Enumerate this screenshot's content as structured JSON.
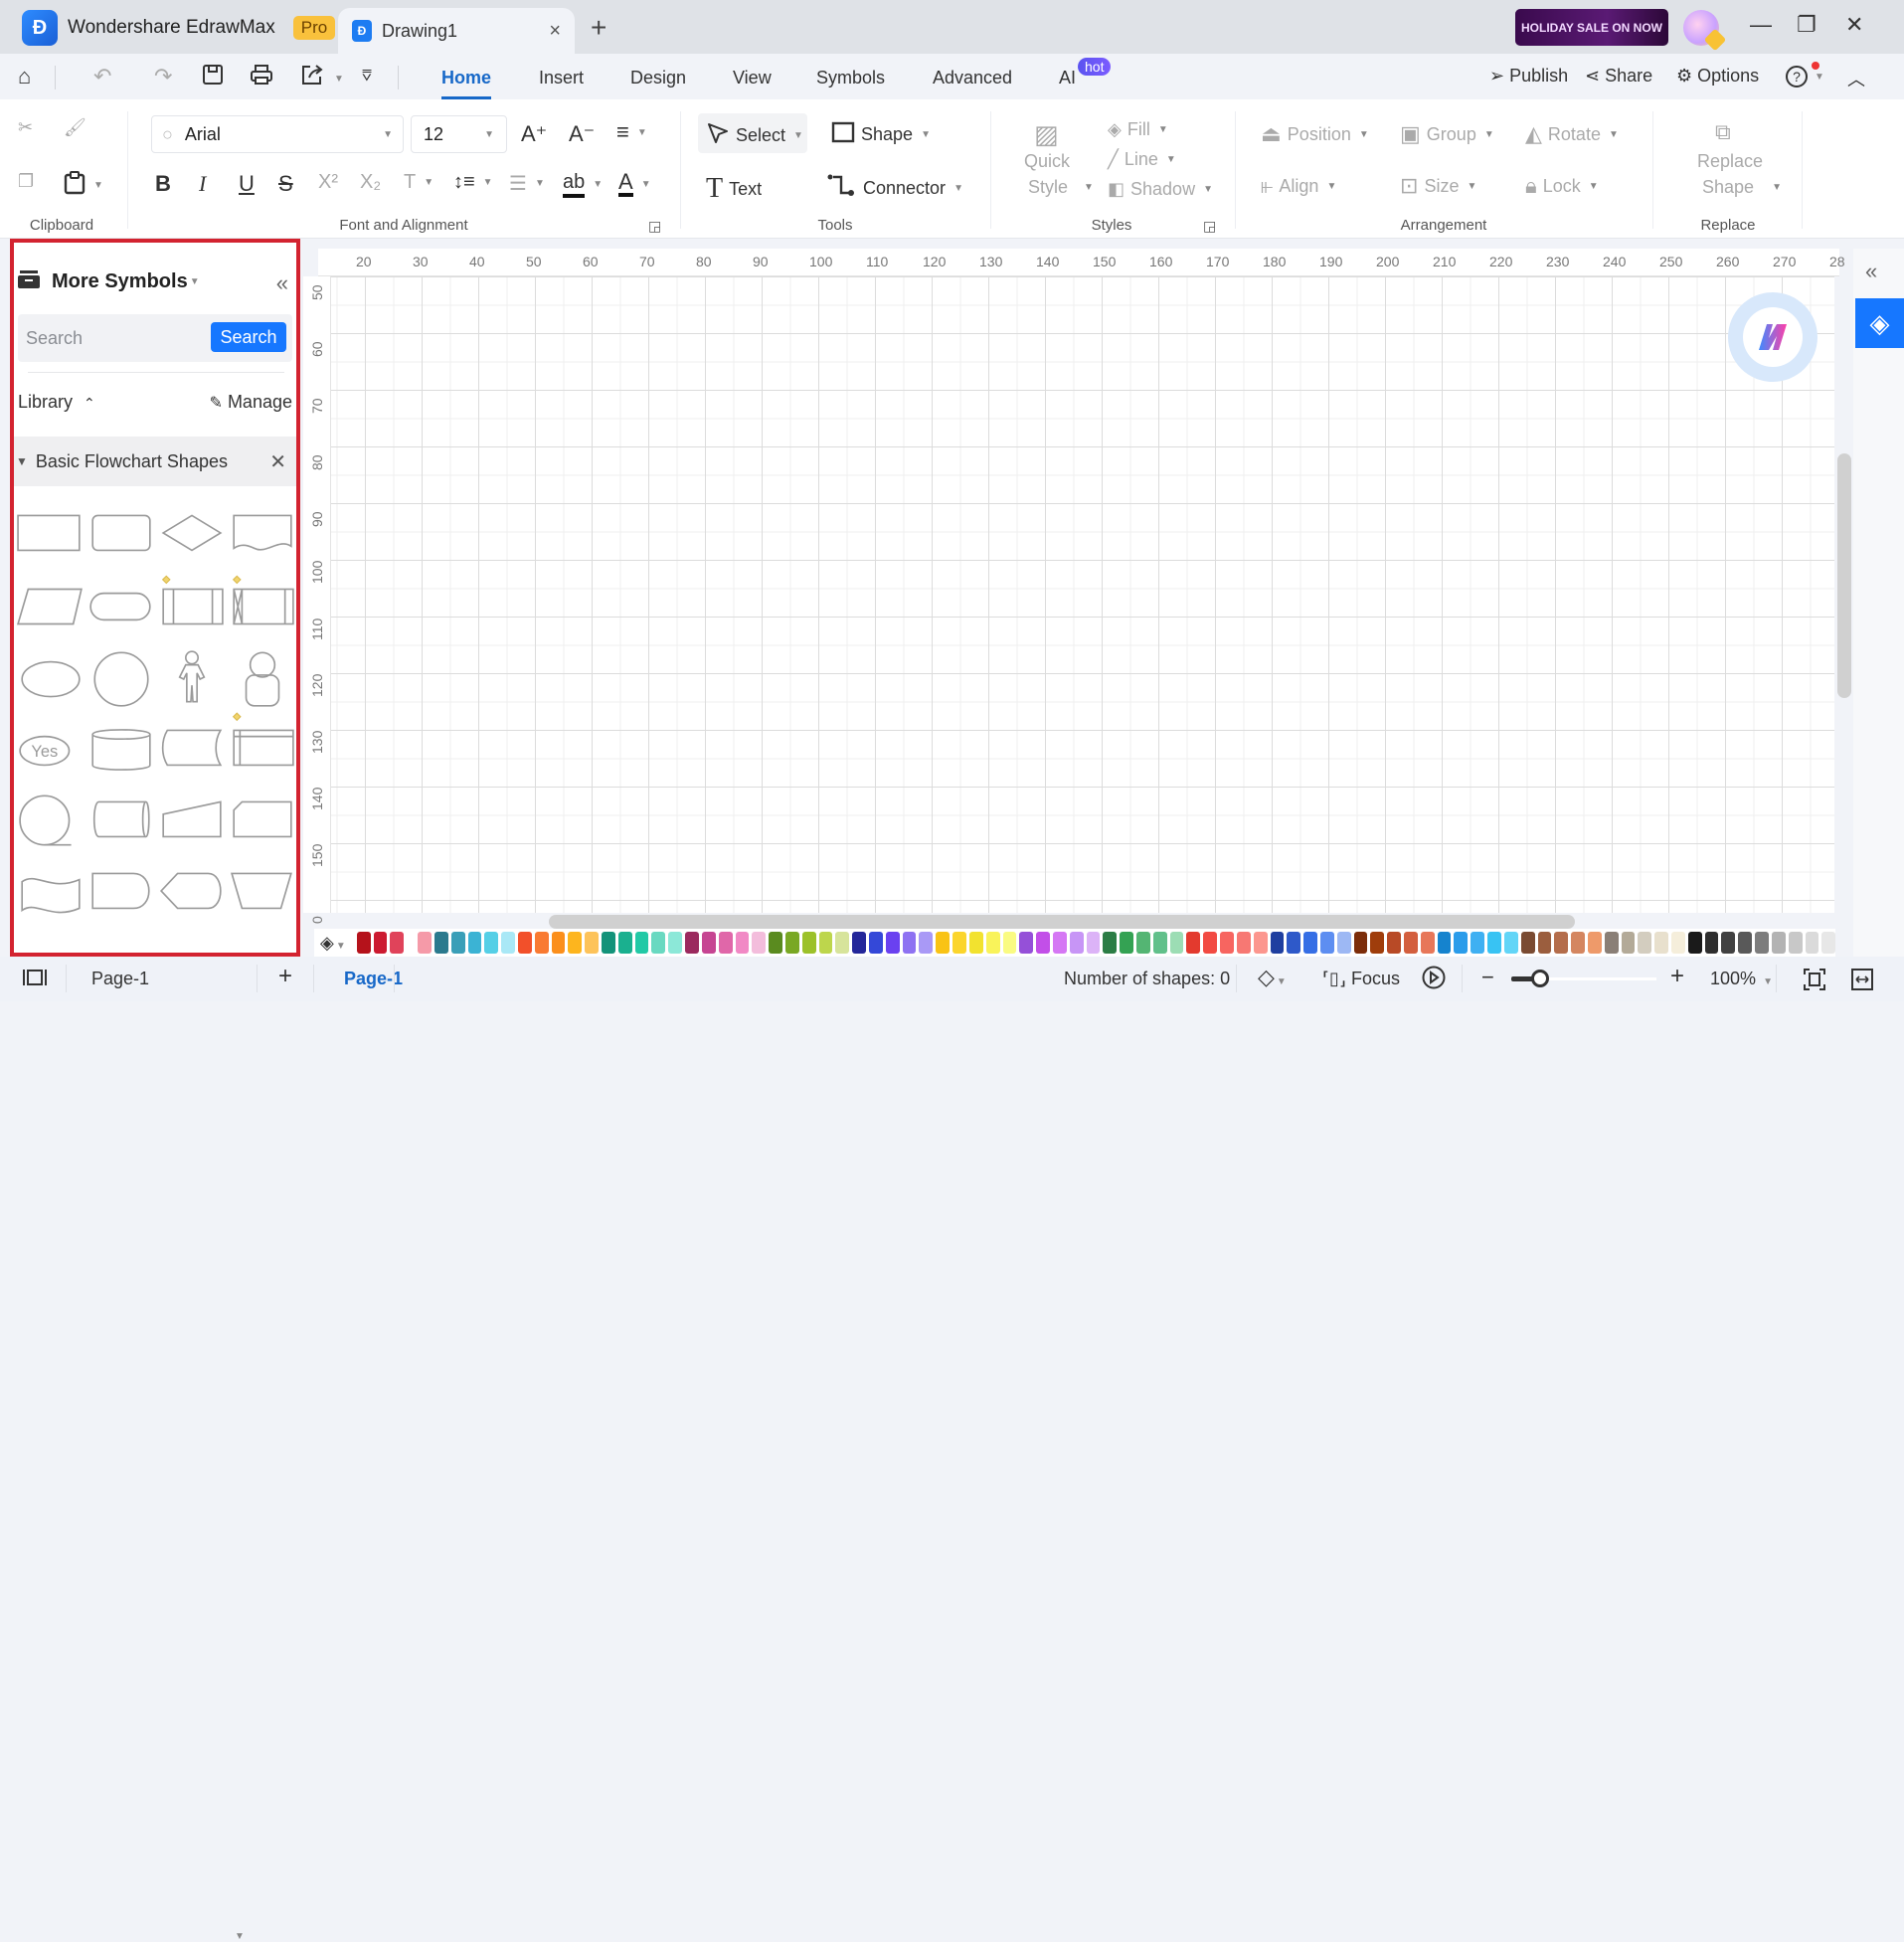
{
  "titlebar": {
    "app_name": "Wondershare EdrawMax",
    "pro_badge": "Pro",
    "doc_tab": "Drawing1",
    "tab_close": "×",
    "new_tab": "+",
    "sale_banner": "HOLIDAY SALE ON NOW",
    "window_controls": {
      "minimize": "—",
      "restore": "❐",
      "close": "✕"
    }
  },
  "quick_access": {
    "home": "⌂",
    "undo": "↶",
    "redo": "↷",
    "save": "💾",
    "print": "⎙",
    "export": "⇱",
    "more": "⩢"
  },
  "menu": {
    "tabs": [
      "Home",
      "Insert",
      "Design",
      "View",
      "Symbols",
      "Advanced",
      "AI"
    ],
    "active": "Home",
    "ai_badge": "hot",
    "actions": {
      "publish": "Publish",
      "share": "Share",
      "options": "Options",
      "help": "?"
    }
  },
  "ribbon": {
    "clipboard": {
      "label": "Clipboard",
      "cut": "✂",
      "format_painter": "🖌",
      "copy": "❐",
      "paste": "📋"
    },
    "font": {
      "label": "Font and Alignment",
      "font_name": "Arial",
      "font_size": "12",
      "grow": "A⁺",
      "shrink": "A⁻",
      "align": "≡",
      "bold": "B",
      "italic": "I",
      "underline": "U",
      "strike": "S",
      "superscript": "X²",
      "subscript": "X₂",
      "text_style": "T",
      "line_spacing": "↕≡",
      "list": "☰",
      "highlight": "ab",
      "font_color": "A"
    },
    "tools": {
      "label": "Tools",
      "select": "Select",
      "shape": "Shape",
      "text": "Text",
      "connector": "Connector"
    },
    "styles": {
      "label": "Styles",
      "quick_style_1": "Quick",
      "quick_style_2": "Style",
      "fill": "Fill",
      "line": "Line",
      "shadow": "Shadow"
    },
    "arrangement": {
      "label": "Arrangement",
      "position": "Position",
      "group": "Group",
      "rotate": "Rotate",
      "align": "Align",
      "size": "Size",
      "lock": "Lock"
    },
    "replace": {
      "label": "Replace",
      "replace_1": "Replace",
      "replace_2": "Shape"
    }
  },
  "left_panel": {
    "title": "More Symbols",
    "collapse": "«",
    "search_placeholder": "Search",
    "search_button": "Search",
    "library_label": "Library",
    "manage_label": "Manage",
    "category": "Basic Flowchart Shapes",
    "category_close": "✕",
    "shapes": [
      "process",
      "rounded-rectangle",
      "decision",
      "document",
      "data",
      "terminator",
      "predefined-process",
      "stored-data-process",
      "ellipse",
      "circle",
      "actor",
      "user",
      "yes-oval",
      "database",
      "stored-data",
      "internal-storage",
      "sequential-access",
      "direct-access",
      "manual-input",
      "card",
      "paper-tape",
      "delay",
      "display",
      "manual-operation"
    ],
    "yes_label": "Yes"
  },
  "canvas": {
    "ruler_top": [
      "20",
      "30",
      "40",
      "50",
      "60",
      "70",
      "80",
      "90",
      "100",
      "110",
      "120",
      "130",
      "140",
      "150",
      "160",
      "170",
      "180",
      "190",
      "200",
      "210",
      "220",
      "230",
      "240",
      "250",
      "260",
      "270",
      "28"
    ],
    "ruler_left": [
      "50",
      "60",
      "70",
      "80",
      "90",
      "100",
      "110",
      "120",
      "130",
      "140",
      "150",
      "0"
    ]
  },
  "palette": {
    "colors": [
      "#b5121b",
      "#cc1a30",
      "#e0435a",
      "#ffffff",
      "#f59aa8",
      "#2b7a8e",
      "#3a9fb8",
      "#3bb3d4",
      "#55cfe6",
      "#a9e8f6",
      "#f2502a",
      "#f97a32",
      "#fb8f1c",
      "#fdb51e",
      "#fdc35a",
      "#13937a",
      "#1ab08f",
      "#22c9a6",
      "#69d9c1",
      "#8ce8d8",
      "#9b2a5e",
      "#c64592",
      "#e067a9",
      "#f189c5",
      "#f3bddc",
      "#5a8b1f",
      "#79a824",
      "#9cc12a",
      "#bdd64c",
      "#d7e49b",
      "#24279a",
      "#3448d8",
      "#6a41f0",
      "#8e72f2",
      "#a999f6",
      "#f9c315",
      "#fbd52c",
      "#f2e22f",
      "#f9f35a",
      "#fafb82",
      "#9550d8",
      "#c24fe8",
      "#d577f4",
      "#c795f6",
      "#dcb3f7",
      "#2b7d45",
      "#34a253",
      "#54b573",
      "#61c08a",
      "#9cddb4",
      "#e33a2e",
      "#f24a42",
      "#f76560",
      "#f77873",
      "#fc968e",
      "#1f3fa0",
      "#2e59c9",
      "#356ee5",
      "#5d8ef1",
      "#9db8f4",
      "#7c2d0a",
      "#9f3d0b",
      "#b84a26",
      "#d35f3e",
      "#e77759",
      "#1583ce",
      "#2a9cea",
      "#3fb0f2",
      "#38c3f3",
      "#62d5f7",
      "#7a4b32",
      "#9b5e3e",
      "#b46d4b",
      "#d48660",
      "#ee9a6a",
      "#8a7f76",
      "#b3aa98",
      "#d3cdbf",
      "#e8e0cd",
      "#f5eedb",
      "#1a1a1a",
      "#2e2e2e",
      "#414141",
      "#595959",
      "#7d7d7d",
      "#b3b3b3",
      "#c8c8c8",
      "#dadada",
      "#e7e7e7"
    ]
  },
  "statusbar": {
    "page_dropdown": "Page-1",
    "add_page": "+",
    "active_page": "Page-1",
    "shape_count": "Number of shapes: 0",
    "focus": "Focus",
    "zoom_minus": "−",
    "zoom_plus": "+",
    "zoom_level": "100%",
    "zoom_fraction": 0.2
  }
}
